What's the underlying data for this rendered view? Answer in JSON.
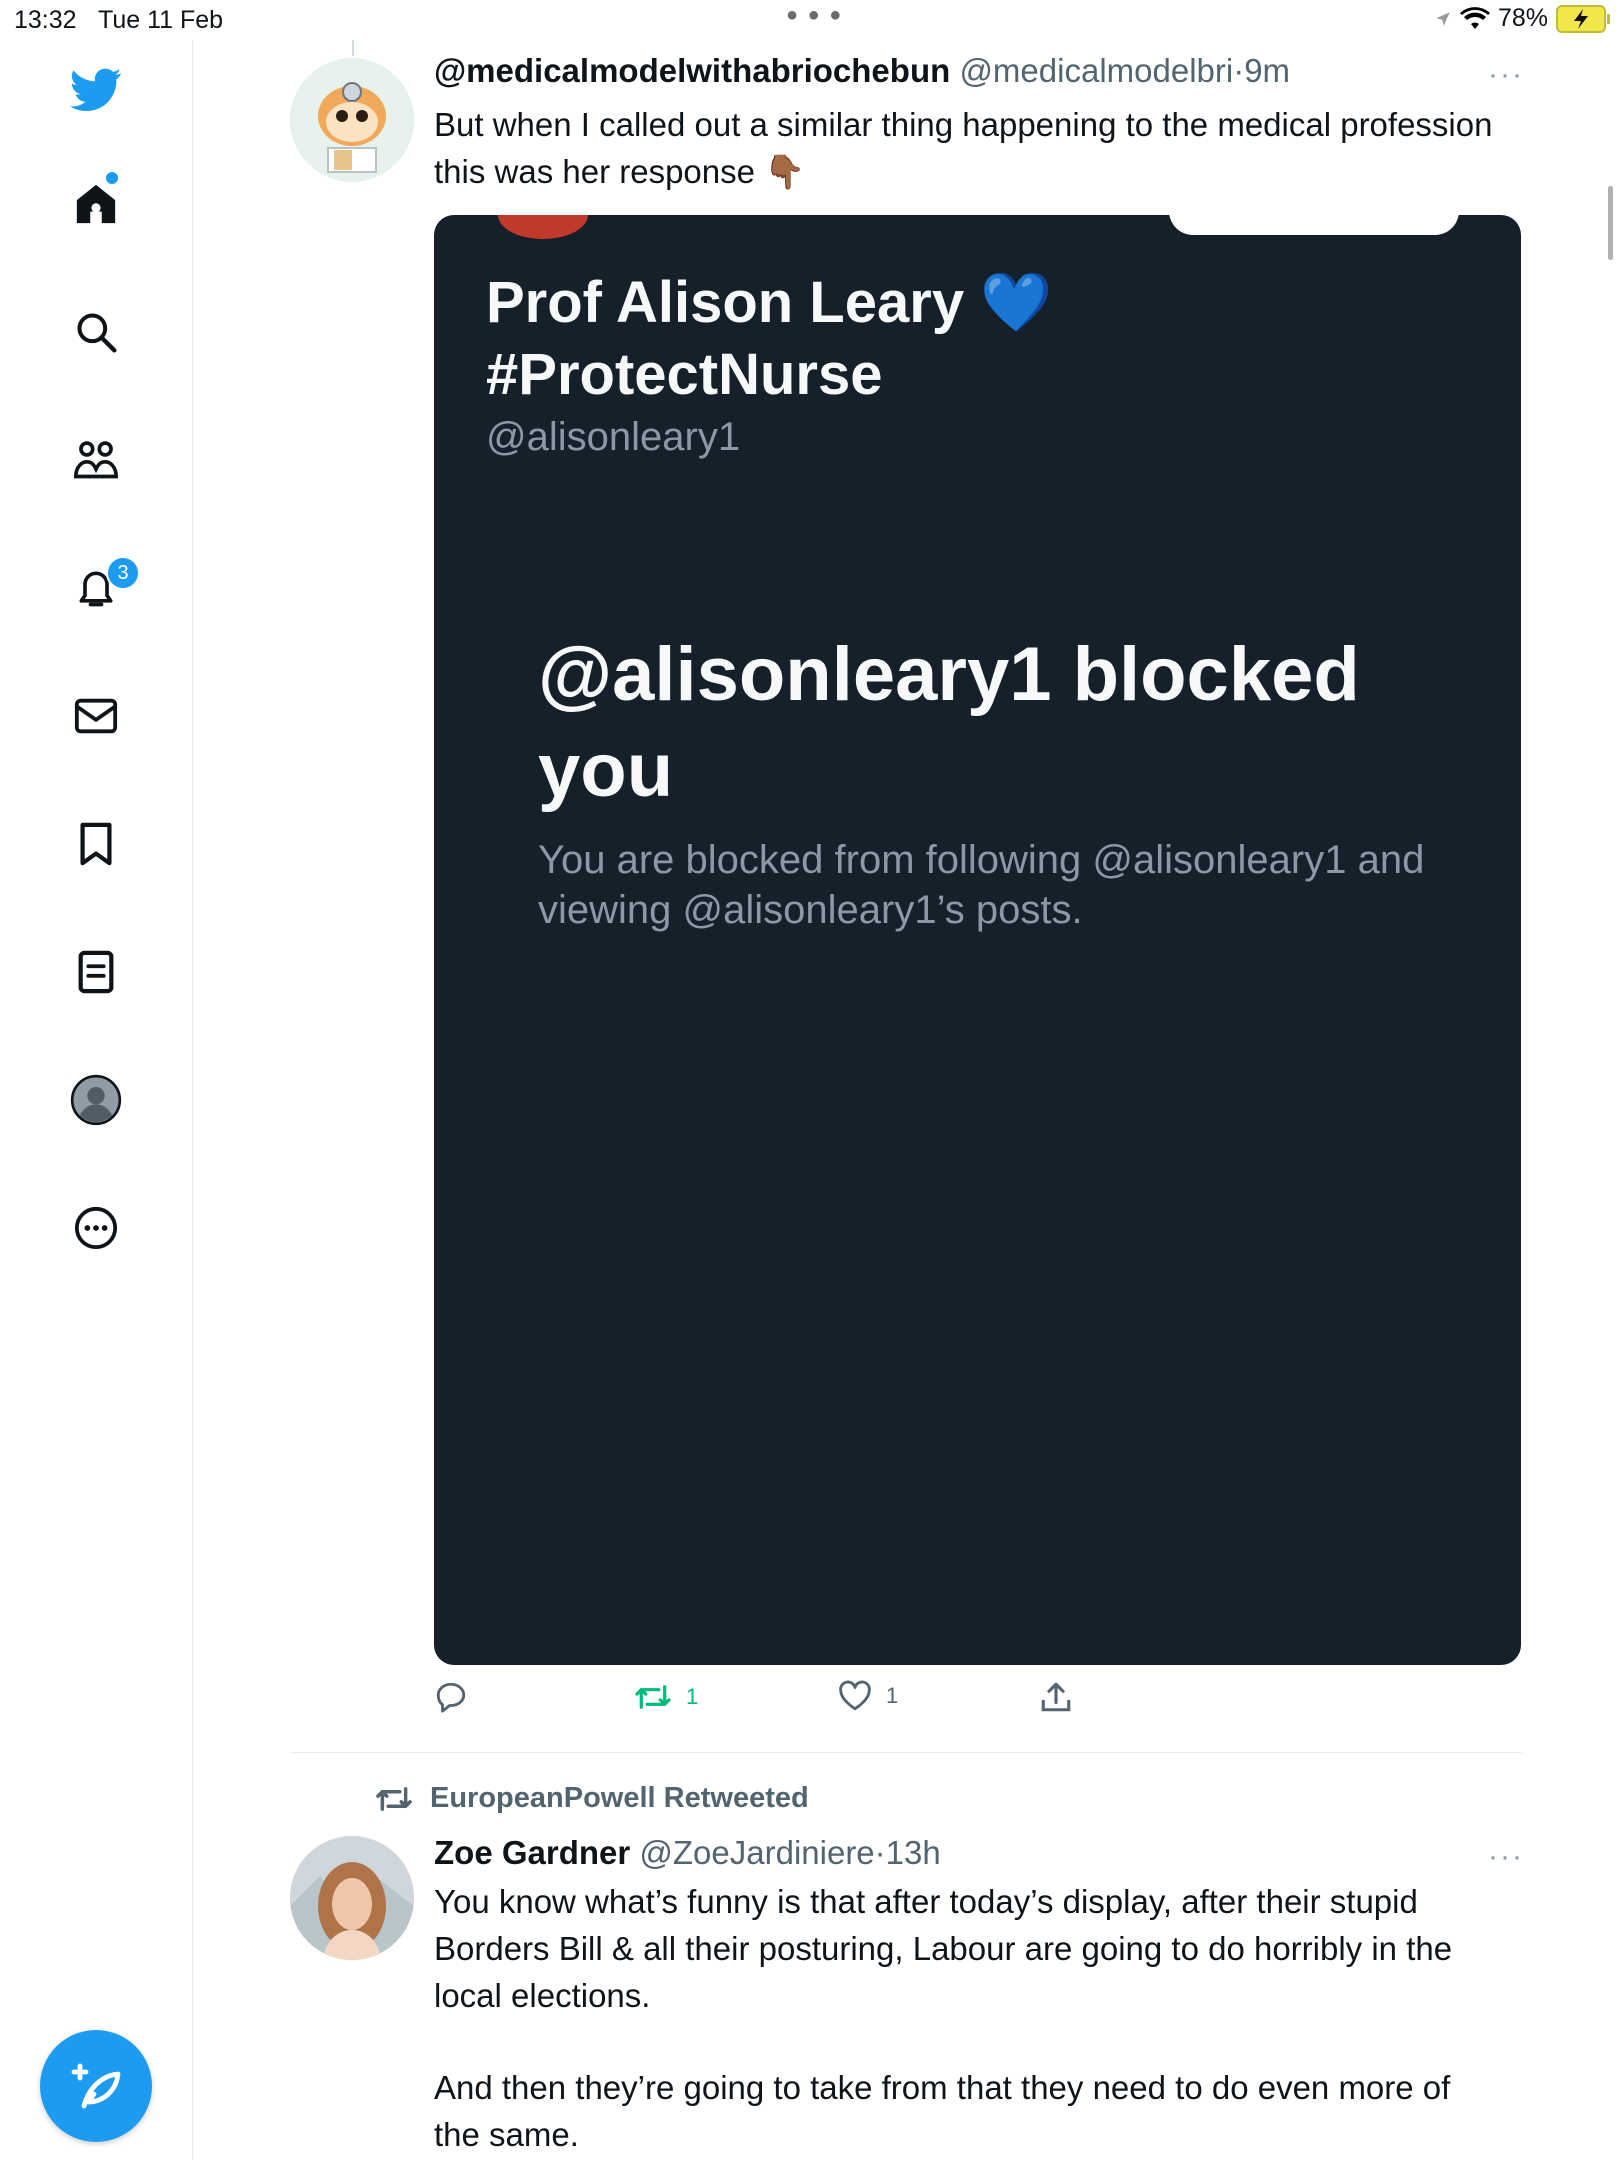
{
  "status_bar": {
    "time": "13:32",
    "date": "Tue 11 Feb",
    "battery": "78%"
  },
  "sidebar": {
    "items": [
      {
        "name": "home"
      },
      {
        "name": "search"
      },
      {
        "name": "communities"
      },
      {
        "name": "notifications",
        "badge": "3"
      },
      {
        "name": "messages"
      },
      {
        "name": "bookmarks"
      },
      {
        "name": "lists"
      },
      {
        "name": "profile"
      },
      {
        "name": "more"
      }
    ],
    "accent": "#1d9bf0"
  },
  "tweet1": {
    "name": "@medicalmodelwithabriochebun",
    "handle": "@medicalmodelbri",
    "separator": "·",
    "time": "9m",
    "more": "···",
    "text": "But when I called out a similar thing happening to the medical profession this was her response 👇🏾",
    "media": {
      "profile_name_line1": "Prof Alison Leary 💙",
      "profile_name_line2": "#ProtectNurse",
      "profile_handle": "@alisonleary1",
      "blocked_title": "@alisonleary1 blocked you",
      "blocked_desc": "You are blocked from following @alisonleary1 and viewing @alisonleary1’s posts."
    },
    "actions": {
      "retweets": "1",
      "likes": "1"
    }
  },
  "tweet2": {
    "retweeted_by": "EuropeanPowell Retweeted",
    "name": "Zoe Gardner",
    "handle": "@ZoeJardiniere",
    "separator": "·",
    "time": "13h",
    "more": "···",
    "text_p1": "You know what’s funny is that after today’s display, after their stupid Borders Bill & all their posturing, Labour are going to do horribly in the local elections.",
    "text_p2": "And then they’re going to take from that they need to do even more of the same."
  }
}
